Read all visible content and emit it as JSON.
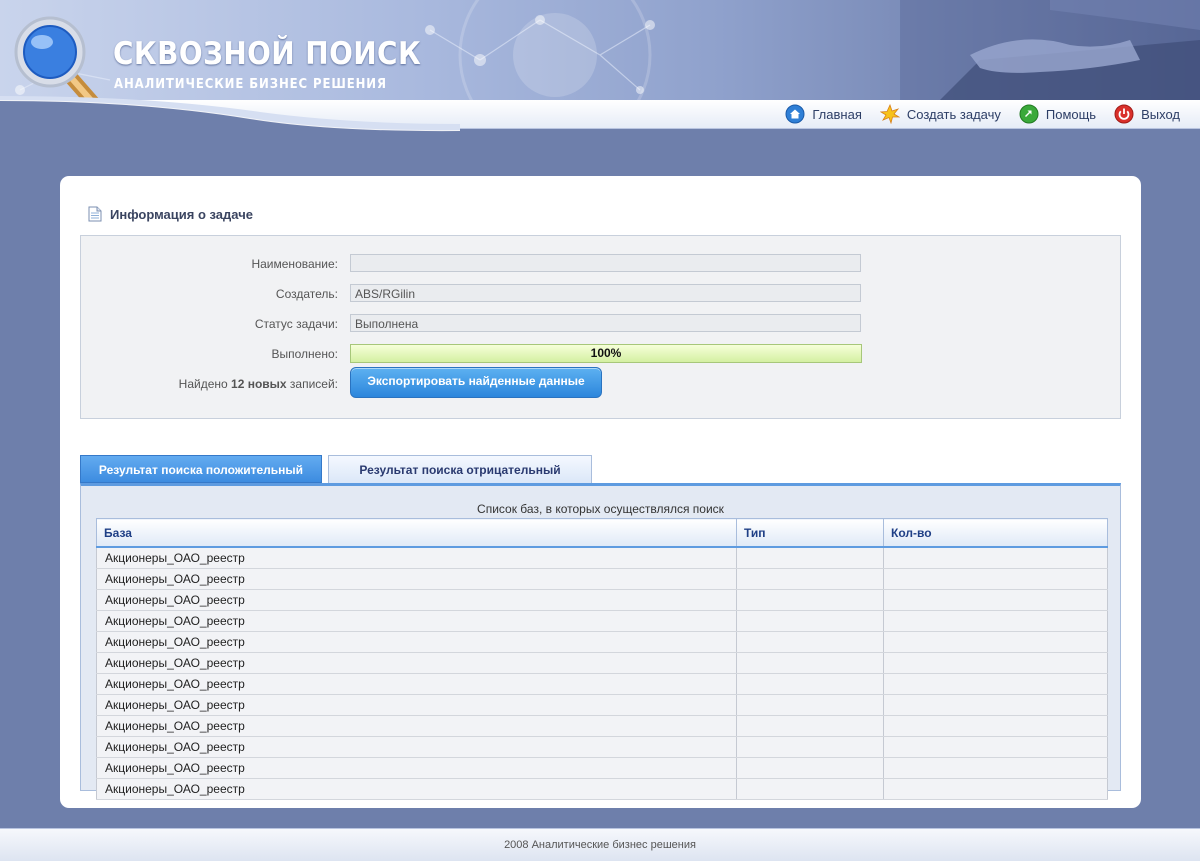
{
  "brand": {
    "title": "СКВОЗНОЙ ПОИСК",
    "subtitle": "АНАЛИТИЧЕСКИЕ БИЗНЕС РЕШЕНИЯ"
  },
  "nav": [
    {
      "label": "Главная",
      "icon": "home-icon"
    },
    {
      "label": "Создать задачу",
      "icon": "star-icon"
    },
    {
      "label": "Помощь",
      "icon": "help-icon"
    },
    {
      "label": "Выход",
      "icon": "power-icon"
    }
  ],
  "task_info": {
    "heading": "Информация о задаче",
    "name_label": "Наименование:",
    "name_value": "",
    "creator_label": "Создатель:",
    "creator_value": "ABS/RGilin",
    "status_label": "Статус задачи:",
    "status_value": "Выполнена",
    "progress_label": "Выполнено:",
    "progress_value": "100%",
    "progress_fraction": 1.0,
    "found_prefix": "Найдено ",
    "found_count": "12 новых",
    "found_suffix": " записей:",
    "export_label": "Экспортировать найденные данные"
  },
  "tabs": [
    {
      "label": "Результат поиска положительный",
      "active": true
    },
    {
      "label": "Результат поиска отрицательный",
      "active": false
    }
  ],
  "results": {
    "caption": "Список баз, в которых осуществлялся поиск",
    "columns": [
      "База",
      "Тип",
      "Кол-во"
    ],
    "rows": [
      [
        "Акционеры_ОАО_реестр",
        "",
        ""
      ],
      [
        "Акционеры_ОАО_реестр",
        "",
        ""
      ],
      [
        "Акционеры_ОАО_реестр",
        "",
        ""
      ],
      [
        "Акционеры_ОАО_реестр",
        "",
        ""
      ],
      [
        "Акционеры_ОАО_реестр",
        "",
        ""
      ],
      [
        "Акционеры_ОАО_реестр",
        "",
        ""
      ],
      [
        "Акционеры_ОАО_реестр",
        "",
        ""
      ],
      [
        "Акционеры_ОАО_реестр",
        "",
        ""
      ],
      [
        "Акционеры_ОАО_реестр",
        "",
        ""
      ],
      [
        "Акционеры_ОАО_реестр",
        "",
        ""
      ],
      [
        "Акционеры_ОАО_реестр",
        "",
        ""
      ],
      [
        "Акционеры_ОАО_реестр",
        "",
        ""
      ]
    ]
  },
  "footer": {
    "text": "2008 Аналитические бизнес решения"
  },
  "colors": {
    "page_bg": "#6e7fab",
    "accent": "#3d8ce0",
    "progress_fill": "#d4f0a2"
  }
}
